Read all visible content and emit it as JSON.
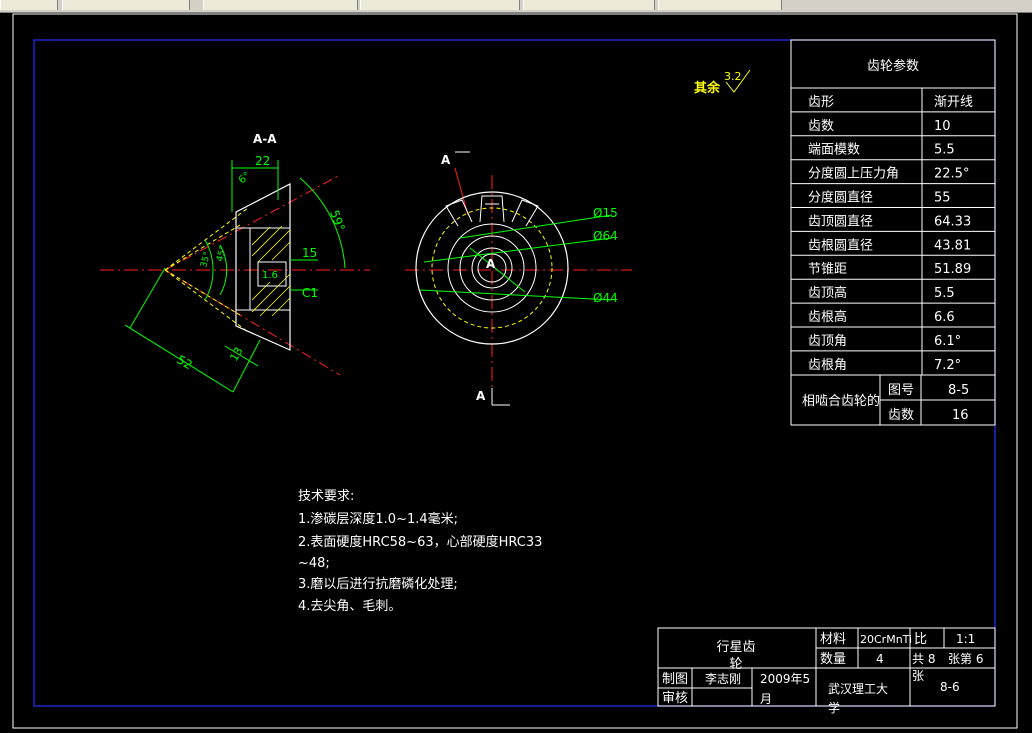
{
  "window": {
    "tabs": [
      {
        "label": ""
      },
      {
        "label": ""
      },
      {
        "label": ""
      },
      {
        "label": ""
      },
      {
        "label": ""
      },
      {
        "label": ""
      }
    ]
  },
  "section_view": {
    "title": "A-A",
    "dims": {
      "width_top": "22",
      "angle_small": "6°",
      "angle_large": "59°",
      "depth": "15",
      "chamfer": "C1",
      "small_dim": "1.6",
      "bottom_dim": "13",
      "length": "52",
      "angle_a": "35°",
      "angle_b": "45°"
    }
  },
  "front_view": {
    "section_label_top": "A",
    "section_label_bottom": "A",
    "center_label": "A",
    "dia_bore": "Ø15",
    "dia_top": "Ø64",
    "dia_root": "Ø44"
  },
  "roughness": {
    "label": "其余",
    "value": "3.2"
  },
  "param_table": {
    "title": "齿轮参数",
    "rows": [
      {
        "name": "齿形",
        "value": "渐开线"
      },
      {
        "name": "齿数",
        "value": "10"
      },
      {
        "name": "端面模数",
        "value": "5.5"
      },
      {
        "name": "分度圆上压力角",
        "value": "22.5°"
      },
      {
        "name": "分度圆直径",
        "value": "55"
      },
      {
        "name": "齿顶圆直径",
        "value": "64.33"
      },
      {
        "name": "齿根圆直径",
        "value": "43.81"
      },
      {
        "name": "节锥距",
        "value": "51.89"
      },
      {
        "name": "齿顶高",
        "value": "5.5"
      },
      {
        "name": "齿根高",
        "value": "6.6"
      },
      {
        "name": "齿顶角",
        "value": "6.1°"
      },
      {
        "name": "齿根角",
        "value": "7.2°"
      }
    ],
    "mating": {
      "label": "相啮合齿轮的",
      "row1_name": "图号",
      "row1_value": "8-5",
      "row2_name": "齿数",
      "row2_value": "16"
    }
  },
  "tech_requirements": {
    "title": "技术要求:",
    "lines": [
      "1.渗碳层深度1.0~1.4毫米;",
      "2.表面硬度HRC58~63，心部硬度HRC33",
      "~48;",
      "3.磨以后进行抗磨磷化处理;",
      "4.去尖角、毛刺。"
    ]
  },
  "title_block": {
    "part_name_1": "行星齿",
    "part_name_2": "轮",
    "material_label": "材料",
    "material_value": "20CrMnTi",
    "scale_label": "比",
    "scale_value": "1:1",
    "qty_label": "数量",
    "qty_value": "4",
    "sheets_a": "共 8",
    "sheets_b": "张第 6",
    "sheets_c": "张",
    "drawn_label": "制图",
    "drawn_name": "李志刚",
    "date_1": "2009年5",
    "date_2": "月",
    "check_label": "审核",
    "school_1": "武汉理工大",
    "school_2": "学",
    "drawing_no": "8-6"
  }
}
